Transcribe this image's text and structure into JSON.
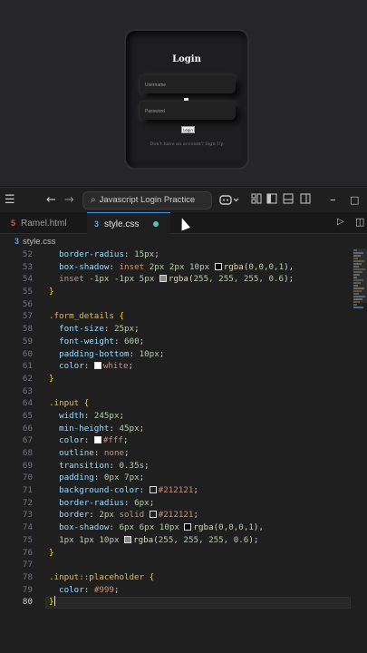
{
  "preview": {
    "title": "Login",
    "username_placeholder": "Username",
    "password_placeholder": "Password",
    "button_label": "Login",
    "signup_text": "Don't have an account? Sign Up"
  },
  "titlebar": {
    "search_text": "Javascript Login Practice"
  },
  "tabs": [
    {
      "label": "Ramel.html",
      "type": "html",
      "active": false
    },
    {
      "label": "style.css",
      "type": "css",
      "active": true,
      "unsaved": true
    }
  ],
  "breadcrumb": {
    "file": "style.css"
  },
  "editor": {
    "first_line": 52,
    "active_line": 80,
    "lines": [
      [
        [
          "p",
          "  "
        ],
        [
          "prop",
          "border-radius"
        ],
        [
          "p",
          ": "
        ],
        [
          "num",
          "15px"
        ],
        [
          "p",
          ";"
        ]
      ],
      [
        [
          "p",
          "  "
        ],
        [
          "prop",
          "box-shadow"
        ],
        [
          "p",
          ": "
        ],
        [
          "kw",
          "inset"
        ],
        [
          "p",
          " "
        ],
        [
          "num",
          "2px"
        ],
        [
          "p",
          " "
        ],
        [
          "num",
          "2px"
        ],
        [
          "p",
          " "
        ],
        [
          "num",
          "10px"
        ],
        [
          "p",
          " "
        ],
        [
          "sw",
          "#000000"
        ],
        [
          "fn",
          "rgba"
        ],
        [
          "p",
          "("
        ],
        [
          "num",
          "0,0,0,1"
        ],
        [
          "p",
          "),"
        ]
      ],
      [
        [
          "p",
          "  "
        ],
        [
          "kw",
          "inset"
        ],
        [
          "p",
          " "
        ],
        [
          "num",
          "-1px"
        ],
        [
          "p",
          " "
        ],
        [
          "num",
          "-1px"
        ],
        [
          "p",
          " "
        ],
        [
          "num",
          "5px"
        ],
        [
          "p",
          " "
        ],
        [
          "sw",
          "#8a8a8a"
        ],
        [
          "fn",
          "rgba"
        ],
        [
          "p",
          "("
        ],
        [
          "num",
          "255, 255, 255, 0.6"
        ],
        [
          "p",
          ");"
        ]
      ],
      [
        [
          "brace",
          "}"
        ]
      ],
      [],
      [
        [
          "sel",
          ".form_details"
        ],
        [
          "p",
          " "
        ],
        [
          "brace",
          "{"
        ]
      ],
      [
        [
          "p",
          "  "
        ],
        [
          "prop",
          "font-size"
        ],
        [
          "p",
          ": "
        ],
        [
          "num",
          "25px"
        ],
        [
          "p",
          ";"
        ]
      ],
      [
        [
          "p",
          "  "
        ],
        [
          "prop",
          "font-weight"
        ],
        [
          "p",
          ": "
        ],
        [
          "num",
          "600"
        ],
        [
          "p",
          ";"
        ]
      ],
      [
        [
          "p",
          "  "
        ],
        [
          "prop",
          "padding-bottom"
        ],
        [
          "p",
          ": "
        ],
        [
          "num",
          "10px"
        ],
        [
          "p",
          ";"
        ]
      ],
      [
        [
          "p",
          "  "
        ],
        [
          "prop",
          "color"
        ],
        [
          "p",
          ": "
        ],
        [
          "sw",
          "#ffffff"
        ],
        [
          "kw",
          "white"
        ],
        [
          "p",
          ";"
        ]
      ],
      [
        [
          "brace",
          "}"
        ]
      ],
      [],
      [
        [
          "sel",
          ".input"
        ],
        [
          "p",
          " "
        ],
        [
          "brace",
          "{"
        ]
      ],
      [
        [
          "p",
          "  "
        ],
        [
          "prop",
          "width"
        ],
        [
          "p",
          ": "
        ],
        [
          "num",
          "245px"
        ],
        [
          "p",
          ";"
        ]
      ],
      [
        [
          "p",
          "  "
        ],
        [
          "prop",
          "min-height"
        ],
        [
          "p",
          ": "
        ],
        [
          "num",
          "45px"
        ],
        [
          "p",
          ";"
        ]
      ],
      [
        [
          "p",
          "  "
        ],
        [
          "prop",
          "color"
        ],
        [
          "p",
          ": "
        ],
        [
          "sw",
          "#ffffff"
        ],
        [
          "kw",
          "#fff"
        ],
        [
          "p",
          ";"
        ]
      ],
      [
        [
          "p",
          "  "
        ],
        [
          "prop",
          "outline"
        ],
        [
          "p",
          ": "
        ],
        [
          "kw",
          "none"
        ],
        [
          "p",
          ";"
        ]
      ],
      [
        [
          "p",
          "  "
        ],
        [
          "prop",
          "transition"
        ],
        [
          "p",
          ": "
        ],
        [
          "num",
          "0.35s"
        ],
        [
          "p",
          ";"
        ]
      ],
      [
        [
          "p",
          "  "
        ],
        [
          "prop",
          "padding"
        ],
        [
          "p",
          ": "
        ],
        [
          "num",
          "0px"
        ],
        [
          "p",
          " "
        ],
        [
          "num",
          "7px"
        ],
        [
          "p",
          ";"
        ]
      ],
      [
        [
          "p",
          "  "
        ],
        [
          "prop",
          "background-color"
        ],
        [
          "p",
          ": "
        ],
        [
          "sw",
          "#212121"
        ],
        [
          "kw",
          "#212121"
        ],
        [
          "p",
          ";"
        ]
      ],
      [
        [
          "p",
          "  "
        ],
        [
          "prop",
          "border-radius"
        ],
        [
          "p",
          ": "
        ],
        [
          "num",
          "6px"
        ],
        [
          "p",
          ";"
        ]
      ],
      [
        [
          "p",
          "  "
        ],
        [
          "prop",
          "border"
        ],
        [
          "p",
          ": "
        ],
        [
          "num",
          "2px"
        ],
        [
          "p",
          " "
        ],
        [
          "kw",
          "solid"
        ],
        [
          "p",
          " "
        ],
        [
          "sw",
          "#212121"
        ],
        [
          "kw",
          "#212121"
        ],
        [
          "p",
          ";"
        ]
      ],
      [
        [
          "p",
          "  "
        ],
        [
          "prop",
          "box-shadow"
        ],
        [
          "p",
          ": "
        ],
        [
          "num",
          "6px"
        ],
        [
          "p",
          " "
        ],
        [
          "num",
          "6px"
        ],
        [
          "p",
          " "
        ],
        [
          "num",
          "10px"
        ],
        [
          "p",
          " "
        ],
        [
          "sw",
          "#000000"
        ],
        [
          "fn",
          "rgba"
        ],
        [
          "p",
          "("
        ],
        [
          "num",
          "0,0,0,1"
        ],
        [
          "p",
          "),"
        ]
      ],
      [
        [
          "p",
          "  "
        ],
        [
          "num",
          "1px"
        ],
        [
          "p",
          " "
        ],
        [
          "num",
          "1px"
        ],
        [
          "p",
          " "
        ],
        [
          "num",
          "10px"
        ],
        [
          "p",
          " "
        ],
        [
          "sw",
          "#8a8a8a"
        ],
        [
          "fn",
          "rgba"
        ],
        [
          "p",
          "("
        ],
        [
          "num",
          "255, 255, 255, 0.6"
        ],
        [
          "p",
          ");"
        ]
      ],
      [
        [
          "brace",
          "}"
        ]
      ],
      [],
      [
        [
          "sel",
          ".input::placeholder"
        ],
        [
          "p",
          " "
        ],
        [
          "brace",
          "{"
        ]
      ],
      [
        [
          "p",
          "  "
        ],
        [
          "prop",
          "color"
        ],
        [
          "p",
          ": "
        ],
        [
          "kw",
          "#999"
        ],
        [
          "p",
          ";"
        ]
      ],
      [
        [
          "brace",
          "}"
        ]
      ]
    ]
  },
  "colors": {
    "accent": "#4a90e2",
    "selector": "#d7ba7d",
    "property": "#9cdcfe",
    "number": "#b5cea8",
    "keyword": "#ce9178",
    "function": "#dcdcaa",
    "brace": "#ffd700",
    "unsaved_dot": "#4ec9b0"
  },
  "icons": {
    "menu": "hamburger-icon",
    "back": "arrow-left-icon",
    "forward": "arrow-right-icon",
    "search": "search-icon",
    "copilot": "copilot-icon",
    "run": "play-icon",
    "split": "split-editor-icon"
  }
}
